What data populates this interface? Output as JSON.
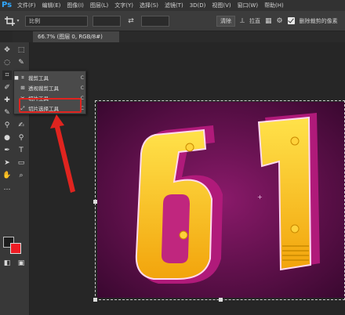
{
  "app": {
    "logo": "Ps"
  },
  "menu": [
    "文件(F)",
    "编辑(E)",
    "图像(I)",
    "图层(L)",
    "文字(Y)",
    "选择(S)",
    "滤镜(T)",
    "3D(D)",
    "视图(V)",
    "窗口(W)",
    "帮助(H)"
  ],
  "options": {
    "ratio_label": "比例",
    "swap_icon": "swap-icon",
    "clear_label": "清除",
    "straighten_label": "拉直",
    "delete_cropped_label": "删除裁剪的像素",
    "delete_cropped_checked": true
  },
  "document": {
    "tab_title": "66.7% (图层 0, RGB/8#)"
  },
  "flyout": {
    "items": [
      {
        "label": "裁剪工具",
        "key": "C",
        "icon": "crop-icon",
        "active": true
      },
      {
        "label": "透视裁剪工具",
        "key": "C",
        "icon": "perspective-crop-icon",
        "active": false
      },
      {
        "label": "切片工具",
        "key": "C",
        "icon": "slice-icon",
        "active": false
      },
      {
        "label": "切片选择工具",
        "key": "C",
        "icon": "slice-select-icon",
        "active": false
      }
    ]
  },
  "colors": {
    "foreground": "#1c1c1c",
    "background": "#ee1c24",
    "annotation": "#e0241f",
    "accent": "#31a8ff"
  },
  "canvas_image": {
    "description_text": "61"
  }
}
